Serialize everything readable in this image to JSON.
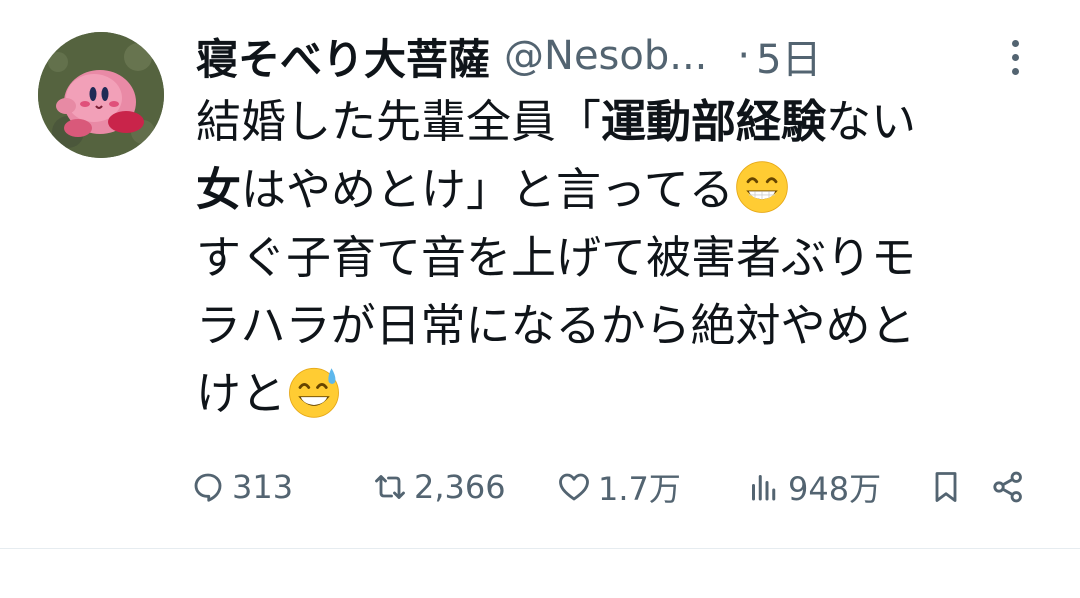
{
  "tweet": {
    "display_name": "寝そべり大菩薩",
    "handle": "@Nesob...",
    "separator": "·",
    "time": "5日",
    "body": {
      "line1_a": "結婚した先輩全員「",
      "line1_bold": "運動部経験",
      "line1_b": "ない",
      "line2_bold": "女",
      "line2_a": "はやめとけ」と言ってる",
      "line3": "すぐ子育て音を上げて被害者ぶりモ",
      "line4": "ラハラが日常になるから絶対やめと",
      "line5": "けと"
    },
    "emoji1": "grinning-face-with-smiling-eyes",
    "emoji2": "grinning-face-with-sweat",
    "actions": {
      "reply_count": "313",
      "retweet_count": "2,366",
      "like_count": "1.7万",
      "view_count": "948万"
    }
  },
  "colors": {
    "text": "#0f1419",
    "muted": "#536471",
    "divider": "#e6ecf0"
  },
  "icons": [
    "more-icon",
    "reply-icon",
    "retweet-icon",
    "like-icon",
    "views-icon",
    "bookmark-icon",
    "share-icon"
  ]
}
